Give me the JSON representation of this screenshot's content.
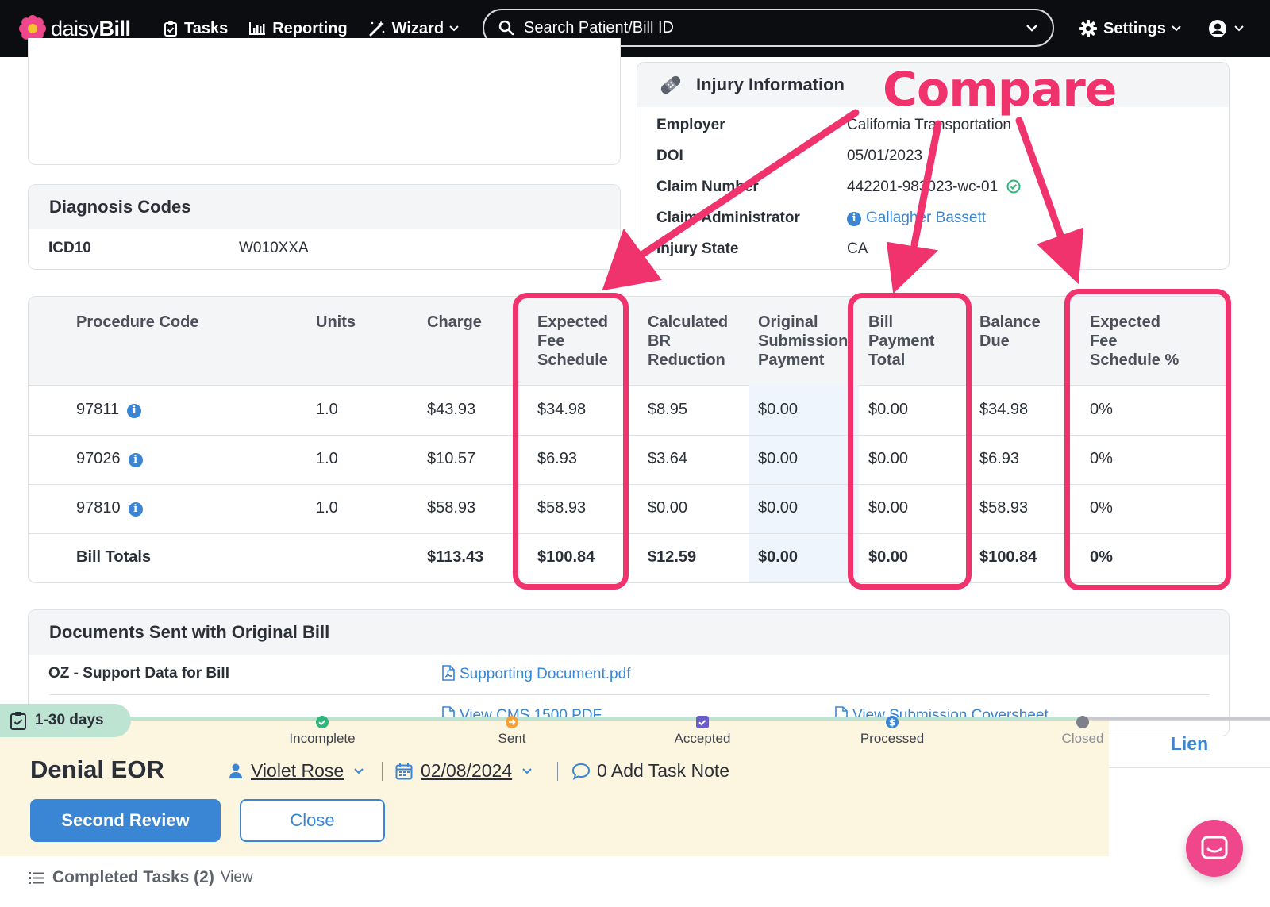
{
  "nav": {
    "brand_light": "daisy",
    "brand_bold": "Bill",
    "tasks": "Tasks",
    "reporting": "Reporting",
    "wizard": "Wizard",
    "search_placeholder": "Search Patient/Bill ID",
    "settings": "Settings"
  },
  "injury": {
    "title": "Injury Information",
    "fields": [
      {
        "label": "Employer",
        "value": "California Transportation"
      },
      {
        "label": "DOI",
        "value": "05/01/2023"
      },
      {
        "label": "Claim Number",
        "value": "442201-983023-wc-01"
      },
      {
        "label": "Claim Administrator",
        "value": "Gallagher Bassett"
      },
      {
        "label": "Injury State",
        "value": "CA"
      }
    ]
  },
  "diagnosis": {
    "title": "Diagnosis Codes",
    "rows": [
      {
        "type": "ICD10",
        "code": "W010XXA"
      }
    ]
  },
  "procedures": {
    "headers": {
      "code": "Procedure Code",
      "units": "Units",
      "charge": "Charge",
      "expected": [
        "Expected",
        "Fee",
        "Schedule"
      ],
      "calc_br": [
        "Calculated",
        "BR",
        "Reduction"
      ],
      "orig_sub": [
        "Original",
        "Submission",
        "Payment"
      ],
      "bill_pay": [
        "Bill",
        "Payment",
        "Total"
      ],
      "balance": [
        "Balance",
        "Due"
      ],
      "expected_pct": [
        "Expected",
        "Fee",
        "Schedule %"
      ]
    },
    "rows": [
      {
        "code": "97811",
        "units": "1.0",
        "charge": "$43.93",
        "expected": "$34.98",
        "calc_br": "$8.95",
        "orig_sub": "$0.00",
        "bill_pay": "$0.00",
        "balance": "$34.98",
        "expected_pct": "0%"
      },
      {
        "code": "97026",
        "units": "1.0",
        "charge": "$10.57",
        "expected": "$6.93",
        "calc_br": "$3.64",
        "orig_sub": "$0.00",
        "bill_pay": "$0.00",
        "balance": "$6.93",
        "expected_pct": "0%"
      },
      {
        "code": "97810",
        "units": "1.0",
        "charge": "$58.93",
        "expected": "$58.93",
        "calc_br": "$0.00",
        "orig_sub": "$0.00",
        "bill_pay": "$0.00",
        "balance": "$58.93",
        "expected_pct": "0%"
      }
    ],
    "totals": {
      "label": "Bill Totals",
      "charge": "$113.43",
      "expected": "$100.84",
      "calc_br": "$12.59",
      "orig_sub": "$0.00",
      "bill_pay": "$0.00",
      "balance": "$100.84",
      "expected_pct": "0%"
    }
  },
  "documents": {
    "title": "Documents Sent with Original Bill",
    "rows": [
      {
        "label": "OZ - Support Data for Bill",
        "file": "Supporting Document.pdf"
      }
    ],
    "links": [
      "View CMS 1500 PDF",
      "View Submission Coversheet"
    ]
  },
  "status": {
    "age": "1-30 days",
    "steps": [
      "Incomplete",
      "Sent",
      "Accepted",
      "Processed",
      "Closed"
    ],
    "bill_type": "Denial EOR",
    "assignee": "Violet Rose",
    "date": "02/08/2024",
    "task_note": "0 Add Task Note",
    "primary_action": "Second Review",
    "secondary_action": "Close",
    "side_tab": "Lien",
    "completed_label": "Completed Tasks (2)",
    "completed_view": "View"
  },
  "annotation": {
    "text": "Compare",
    "color": "#f0326d"
  },
  "colors": {
    "accent": "#3a86d4",
    "highlight": "#f0326d",
    "status_bg": "#fcf5df",
    "progress": "#bde3d2"
  }
}
